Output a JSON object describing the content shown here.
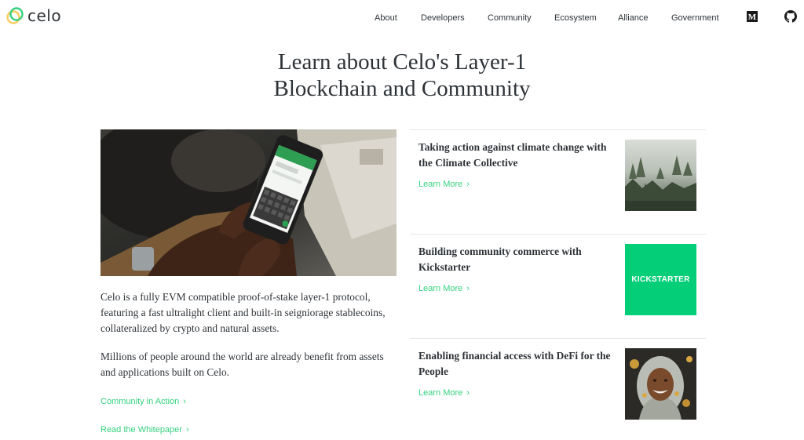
{
  "header": {
    "logo_text": "celo",
    "nav": [
      {
        "label": "About"
      },
      {
        "label": "Developers"
      },
      {
        "label": "Community"
      },
      {
        "label": "Ecosystem"
      },
      {
        "label": "Alliance"
      },
      {
        "label": "Government"
      }
    ],
    "social_icons": [
      "medium-icon",
      "github-icon"
    ]
  },
  "main": {
    "title_line1": "Learn about Celo's Layer-1",
    "title_line2": "Blockchain and Community",
    "hero_image": "hand-holding-phone-image",
    "paragraphs": [
      "Celo is a fully EVM compatible proof-of-stake layer-1 protocol, featuring a fast ultralight client and built-in seigniorage stablecoins, collateralized by crypto and natural assets.",
      "Millions of people around the world are already benefit from assets and applications built on Celo."
    ],
    "links": [
      {
        "label": "Community in Action"
      },
      {
        "label": "Read the Whitepaper"
      }
    ]
  },
  "cards": [
    {
      "title": "Taking action against climate change with the Climate Collective",
      "link": "Learn More",
      "thumb": "misty-forest-image"
    },
    {
      "title": "Building community commerce with Kickstarter",
      "link": "Learn More",
      "thumb": "kickstarter-logo",
      "thumb_text": "KICKSTARTER"
    },
    {
      "title": "Enabling financial access with DeFi for the People",
      "link": "Learn More",
      "thumb": "smiling-woman-image"
    }
  ],
  "colors": {
    "accent": "#35d07f",
    "text": "#2e3338",
    "kickstarter": "#05ce78",
    "divider": "#e6e6e6"
  }
}
